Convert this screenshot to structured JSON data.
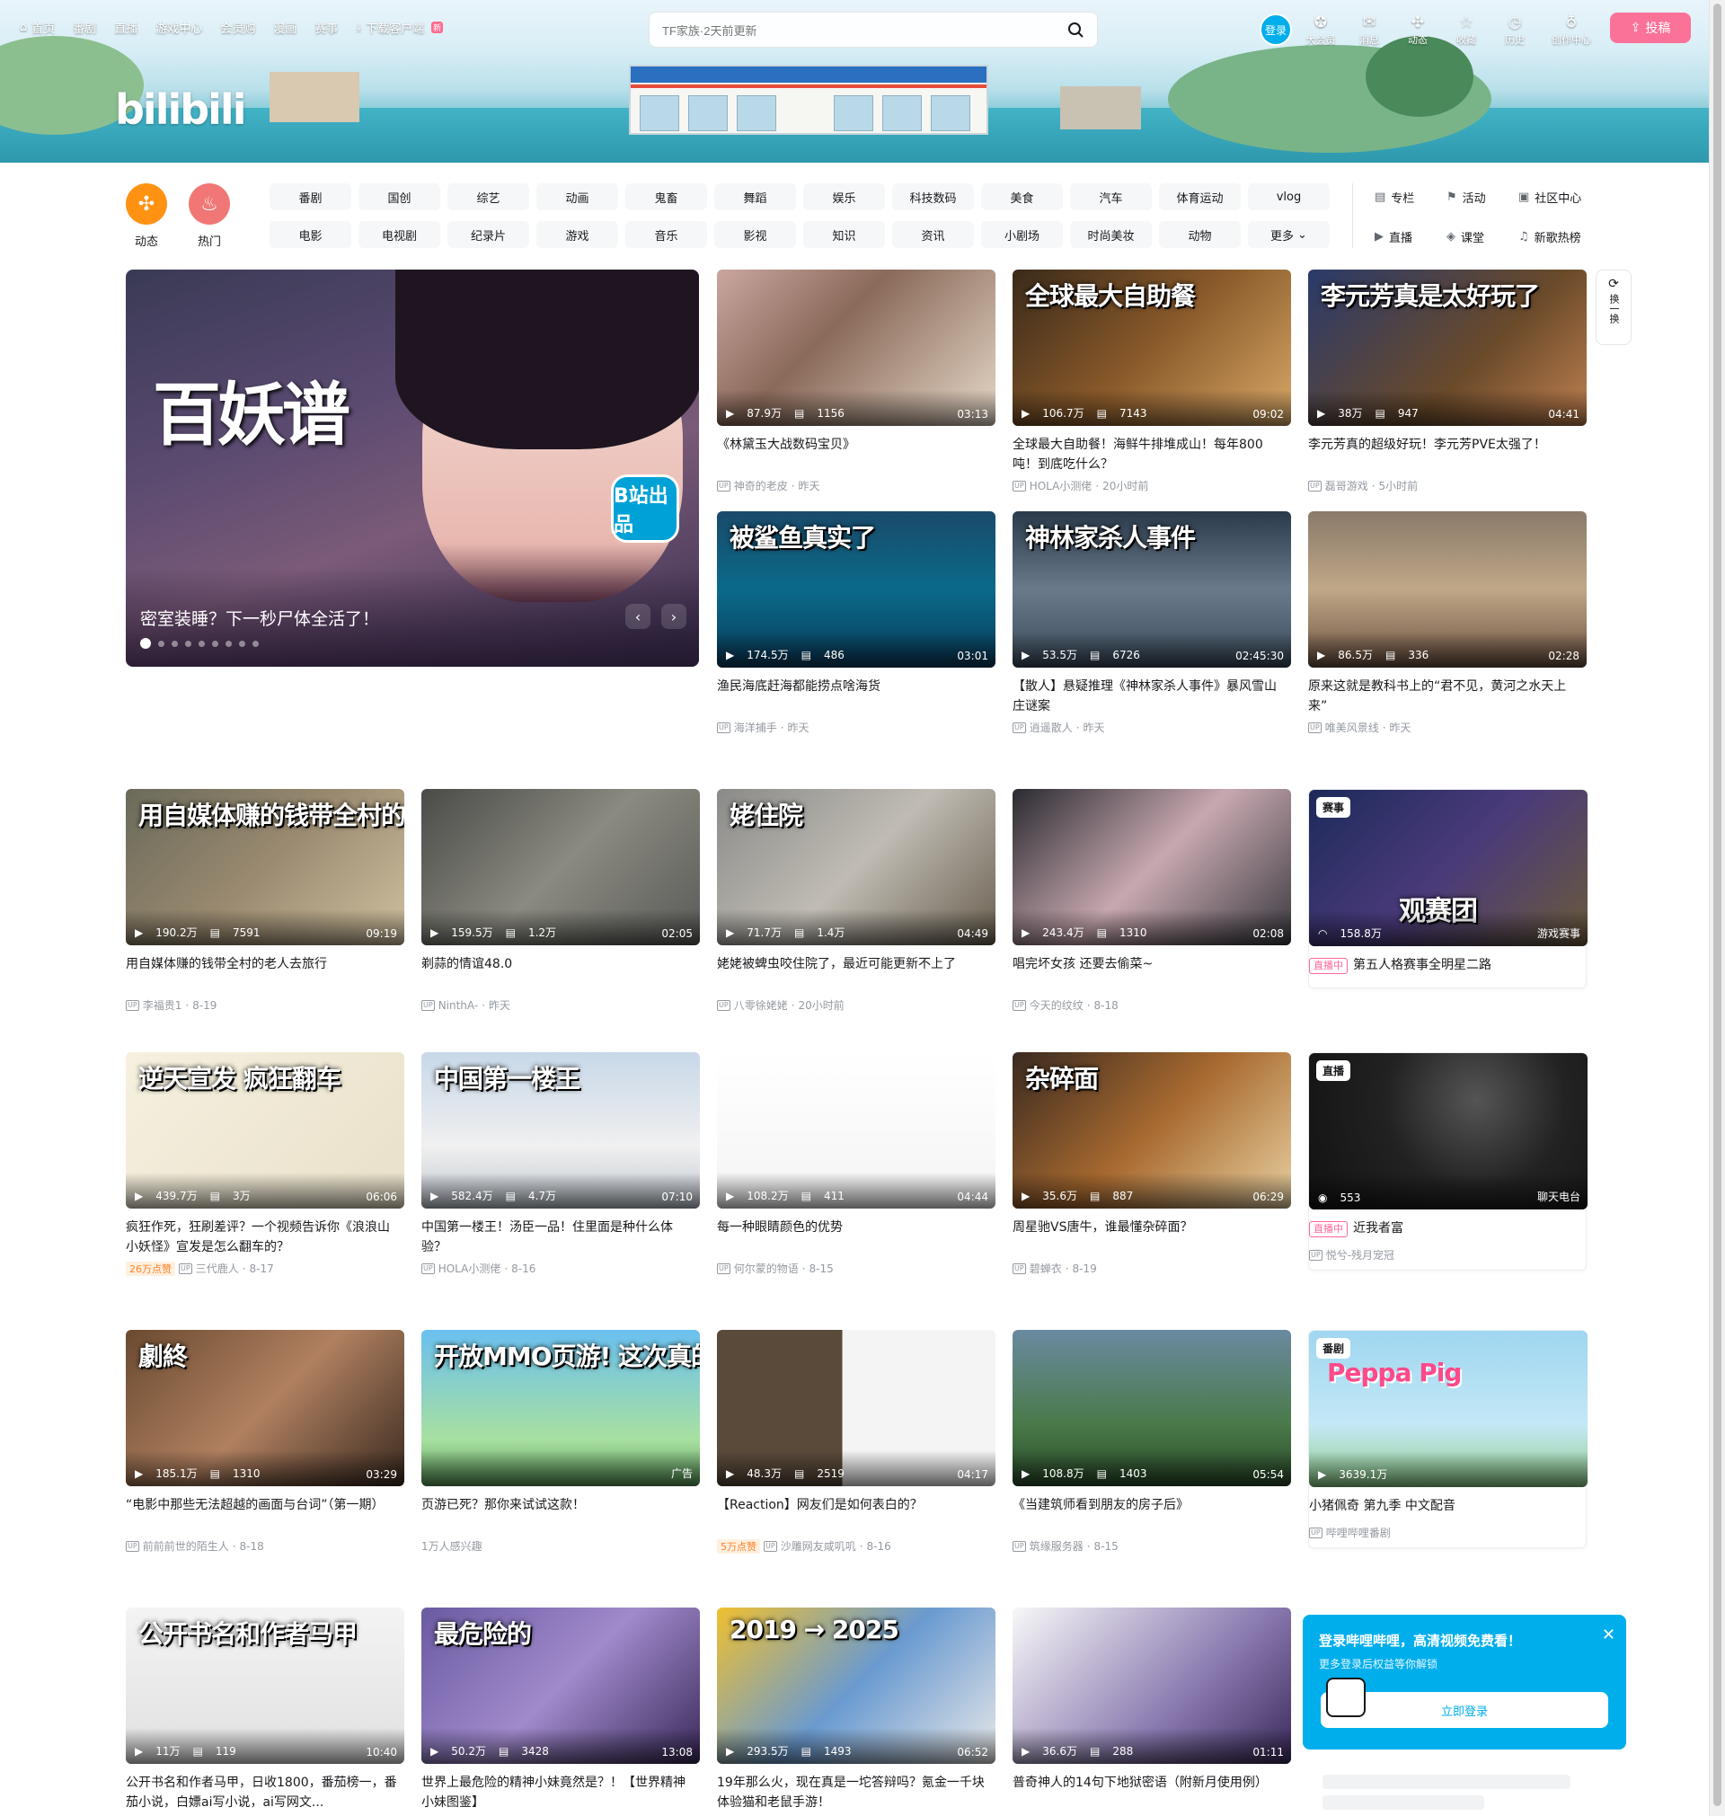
{
  "nav": {
    "items": [
      {
        "icon": "home-icon",
        "label": "首页"
      },
      {
        "label": "番剧"
      },
      {
        "label": "直播"
      },
      {
        "label": "游戏中心"
      },
      {
        "label": "会员购"
      },
      {
        "label": "漫画"
      },
      {
        "label": "赛事"
      },
      {
        "icon": "download-icon",
        "label": "下载客户端",
        "badge": "新"
      }
    ],
    "logo": "bilibili"
  },
  "search": {
    "placeholder": "TF家族·2天前更新"
  },
  "header_right": {
    "login": "登录",
    "items": [
      {
        "icon": "vip-icon",
        "glyph": "✪",
        "label": "大会员"
      },
      {
        "icon": "mail-icon",
        "glyph": "✉",
        "label": "消息"
      },
      {
        "icon": "dynamic-icon",
        "glyph": "✣",
        "label": "动态"
      },
      {
        "icon": "star-icon",
        "glyph": "☆",
        "label": "收藏"
      },
      {
        "icon": "history-icon",
        "glyph": "◷",
        "label": "历史"
      },
      {
        "icon": "bulb-icon",
        "glyph": "♁",
        "label": "创作中心"
      }
    ],
    "upload": "投稿"
  },
  "channels": {
    "round": [
      {
        "label": "动态",
        "color": "#ff9212",
        "glyph": "✣"
      },
      {
        "label": "热门",
        "color": "#f07775",
        "glyph": "♨"
      }
    ],
    "categories": [
      "番剧",
      "国创",
      "综艺",
      "动画",
      "鬼畜",
      "舞蹈",
      "娱乐",
      "科技数码",
      "美食",
      "汽车",
      "体育运动",
      "vlog",
      "电影",
      "电视剧",
      "纪录片",
      "游戏",
      "音乐",
      "影视",
      "知识",
      "资讯",
      "小剧场",
      "时尚美妆",
      "动物",
      "更多"
    ],
    "links": [
      {
        "icon": "column-icon",
        "glyph": "▤",
        "label": "专栏"
      },
      {
        "icon": "flag-icon",
        "glyph": "⚑",
        "label": "活动"
      },
      {
        "icon": "community-icon",
        "glyph": "▣",
        "label": "社区中心"
      },
      {
        "icon": "live-icon",
        "glyph": "▶",
        "label": "直播"
      },
      {
        "icon": "class-icon",
        "glyph": "◈",
        "label": "课堂"
      },
      {
        "icon": "music-icon",
        "glyph": "♫",
        "label": "新歌热榜"
      }
    ]
  },
  "carousel": {
    "title": "密室装睡？下一秒尸体全活了！",
    "art_text": "百妖谱",
    "stamp": "B站出品"
  },
  "refresh": {
    "label": "换一换"
  },
  "videos": [
    {
      "title": "《林黛玉大战数码宝贝》",
      "views": "87.9万",
      "danmaku": "1156",
      "duration": "03:13",
      "up": "神奇的老皮",
      "date": "昨天",
      "thumb_text": ""
    },
    {
      "title": "全球最大自助餐！海鲜牛排堆成山！每年800吨！到底吃什么？",
      "views": "106.7万",
      "danmaku": "7143",
      "duration": "09:02",
      "up": "HOLA小测佬",
      "date": "20小时前",
      "thumb_text": "全球最大自助餐"
    },
    {
      "title": "李元芳真的超级好玩！李元芳PVE太强了！",
      "views": "38万",
      "danmaku": "947",
      "duration": "04:41",
      "up": "磊哥游戏",
      "date": "5小时前",
      "thumb_text": "李元芳真是太好玩了"
    },
    {
      "title": "渔民海底赶海都能捞点啥海货",
      "views": "174.5万",
      "danmaku": "486",
      "duration": "03:01",
      "up": "海洋捕手",
      "date": "昨天",
      "thumb_text": "被鲨鱼真实了"
    },
    {
      "title": "【散人】悬疑推理《神林家杀人事件》暴风雪山庄谜案",
      "views": "53.5万",
      "danmaku": "6726",
      "duration": "02:45:30",
      "up": "逍遥散人",
      "date": "昨天",
      "thumb_text": "神林家杀人事件"
    },
    {
      "title": "原来这就是教科书上的“君不见，黄河之水天上来”",
      "views": "86.5万",
      "danmaku": "336",
      "duration": "02:28",
      "up": "唯美风景线",
      "date": "昨天",
      "thumb_text": ""
    },
    {
      "title": "用自媒体赚的钱带全村的老人去旅行",
      "views": "190.2万",
      "danmaku": "7591",
      "duration": "09:19",
      "up": "李福贵1",
      "date": "8-19",
      "thumb_text": "用自媒体赚的钱带全村的老人去旅行"
    },
    {
      "title": "剃蒜的情谊48.0",
      "views": "159.5万",
      "danmaku": "1.2万",
      "duration": "02:05",
      "up": "NinthA-",
      "date": "昨天",
      "thumb_text": ""
    },
    {
      "title": "姥姥被蜱虫咬住院了，最近可能更新不上了",
      "views": "71.7万",
      "danmaku": "1.4万",
      "duration": "04:49",
      "up": "八零徐姥姥",
      "date": "20小时前",
      "thumb_text": "姥住院"
    },
    {
      "title": "唱完坏女孩 还要去偷菜~",
      "views": "243.4万",
      "danmaku": "1310",
      "duration": "02:08",
      "up": "今天的纹纹",
      "date": "8-18",
      "thumb_text": ""
    },
    {
      "title": "疯狂作死，狂刷差评？一个视频告诉你《浪浪山小妖怪》宣发是怎么翻车的？",
      "views": "439.7万",
      "danmaku": "3万",
      "duration": "06:06",
      "up": "三代鹿人",
      "date": "8-17",
      "hot": "26万点赞",
      "thumb_text": "逆天宣发 疯狂翻车"
    },
    {
      "title": "中国第一楼王！汤臣一品！住里面是种什么体验？",
      "views": "582.4万",
      "danmaku": "4.7万",
      "duration": "07:10",
      "up": "HOLA小测佬",
      "date": "8-16",
      "thumb_text": "中国第一楼王"
    },
    {
      "title": "每一种眼睛颜色的优势",
      "views": "108.2万",
      "danmaku": "411",
      "duration": "04:44",
      "up": "何尔蒙的物语",
      "date": "8-15",
      "thumb_text": ""
    },
    {
      "title": "周星驰VS唐牛，谁最懂杂碎面？",
      "views": "35.6万",
      "danmaku": "887",
      "duration": "06:29",
      "up": "碧蝉衣",
      "date": "8-19",
      "thumb_text": "杂碎面"
    },
    {
      "title": "“电影中那些无法超越的画面与台词”（第一期）",
      "views": "185.1万",
      "danmaku": "1310",
      "duration": "03:29",
      "up": "前前前世的陌生人",
      "date": "8-18",
      "thumb_text": "劇終"
    },
    {
      "title": "页游已死？那你来试试这款！",
      "views": "",
      "danmaku": "",
      "duration": "广告",
      "up": "1万人感兴趣",
      "date": "",
      "ad": true,
      "thumb_text": "开放MMO页游! 这次真的来了"
    },
    {
      "title": "【Reaction】网友们是如何表白的？",
      "views": "48.3万",
      "danmaku": "2519",
      "duration": "04:17",
      "up": "沙雕网友咸叽叽",
      "date": "8-16",
      "hot": "5万点赞",
      "thumb_text": ""
    },
    {
      "title": "《当建筑师看到朋友的房子后》",
      "views": "108.8万",
      "danmaku": "1403",
      "duration": "05:54",
      "up": "筑缘服务器",
      "date": "8-15",
      "thumb_text": ""
    },
    {
      "title": "公开书名和作者马甲，日收1800，番茄榜一，番茄小说，白嫖ai写小说，ai写网文...",
      "views": "11万",
      "danmaku": "119",
      "duration": "10:40",
      "up": "",
      "date": "",
      "thumb_text": "公开书名和作者马甲"
    },
    {
      "title": "世界上最危险的精神小妹竟然是？！【世界精神小妹图鉴】",
      "views": "50.2万",
      "danmaku": "3428",
      "duration": "13:08",
      "up": "",
      "date": "",
      "thumb_text": "最危险的"
    },
    {
      "title": "19年那么火，现在真是一坨答辩吗？氪金一千块体验猫和老鼠手游！",
      "views": "293.5万",
      "danmaku": "1493",
      "duration": "06:52",
      "up": "",
      "date": "",
      "thumb_text": "2019 → 2025"
    },
    {
      "title": "普奇神人的14句下地狱密语（附新月使用例）",
      "views": "36.6万",
      "danmaku": "288",
      "duration": "01:11",
      "up": "",
      "date": "",
      "thumb_text": ""
    }
  ],
  "side_cards": [
    {
      "tag": "赛事",
      "views": "158.8万",
      "corner": "游戏赛事",
      "live": "直播中",
      "title": "第五人格赛事全明星二路",
      "thumb_text": "观赛团"
    },
    {
      "tag": "直播",
      "views": "553",
      "corner": "聊天电台",
      "live": "直播中",
      "title": "近我者富",
      "up": "悦兮-残月宠冠"
    },
    {
      "tag": "番剧",
      "views": "3639.1万",
      "title": "小猪佩奇 第九季 中文配音",
      "up": "哔哩哔哩番剧",
      "thumb_text": "Peppa Pig"
    }
  ],
  "popup": {
    "title": "登录哔哩哔哩，高清视频免费看！",
    "subtitle": "更多登录后权益等你解锁",
    "button": "立即登录"
  }
}
